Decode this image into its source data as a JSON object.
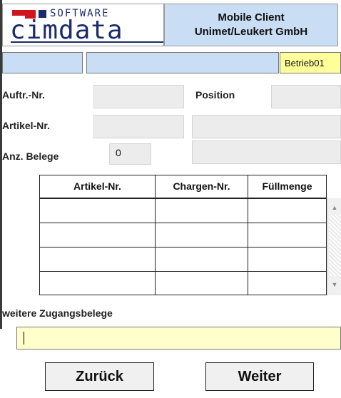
{
  "header": {
    "logo_software": "SOFTWARE",
    "logo_word": "cimdata",
    "title_line1": "Mobile Client",
    "title_line2": "Unimet/Leukert GmbH"
  },
  "status_bar": {
    "field1": "",
    "field2": "",
    "location": "Betrieb01"
  },
  "form": {
    "auftr_label": "Auftr.-Nr.",
    "auftr_value": "",
    "position_label": "Position",
    "position_value": "",
    "artikel_label": "Artikel-Nr.",
    "artikel_value": "",
    "artikel_desc": "",
    "anz_label": "Anz. Belege",
    "anz_value": "0",
    "anz_extra": ""
  },
  "table": {
    "columns": [
      "Artikel-Nr.",
      "Chargen-Nr.",
      "Füllmenge"
    ],
    "rows": [
      [
        "",
        "",
        ""
      ],
      [
        "",
        "",
        ""
      ],
      [
        "",
        "",
        ""
      ],
      [
        "",
        "",
        ""
      ]
    ]
  },
  "weitere": {
    "label": "weitere Zugangsbelege",
    "value": ""
  },
  "buttons": {
    "back": "Zurück",
    "next": "Weiter"
  },
  "colors": {
    "header_blue": "#c9def4",
    "highlight_yellow": "#ffff99",
    "input_yellow": "#ffffcc",
    "field_gray": "#ececec",
    "logo_red": "#d0141e",
    "logo_navy": "#1b2a6b"
  }
}
